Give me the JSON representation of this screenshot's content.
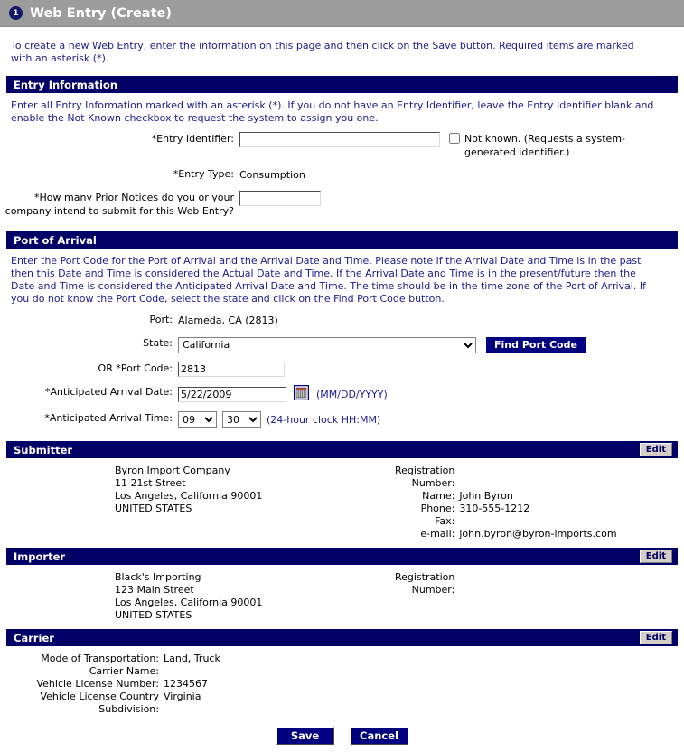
{
  "header": {
    "step_number": "1",
    "title": "Web Entry (Create)"
  },
  "intro": "To create a new Web Entry, enter the information on this page and then click on the Save button. Required items are marked with an asterisk (*).",
  "entry_information": {
    "section_title": "Entry Information",
    "description": "Enter all Entry Information marked with an asterisk (*). If you do not have an Entry Identifier, leave the Entry Identifier blank and enable the Not Known checkbox to request the system to assign you one.",
    "entry_identifier_label": "*Entry Identifier:",
    "entry_identifier_value": "",
    "not_known_label": "Not known. (Requests a system-generated identifier.)",
    "not_known_checked": false,
    "entry_type_label": "*Entry Type:",
    "entry_type_value": "Consumption",
    "prior_notices_label": "*How many Prior Notices do you or your company intend to submit for this Web Entry?",
    "prior_notices_value": ""
  },
  "port_of_arrival": {
    "section_title": "Port of Arrival",
    "description": "Enter the Port Code for the Port of Arrival and the Arrival Date and Time. Please note if the Arrival Date and Time is in the past then this Date and Time is considered the Actual Date and Time. If the Arrival Date and Time is in the present/future then the Date and Time is considered the Anticipated Arrival Date and Time. The time should be in the time zone of the Port of Arrival. If you do not know the Port Code, select the state and click on the Find Port Code button.",
    "port_label": "Port:",
    "port_value": "Alameda, CA (2813)",
    "state_label": "State:",
    "state_value": "California",
    "state_options": [
      "California"
    ],
    "find_port_code_label": "Find Port Code",
    "port_code_label": "OR *Port Code:",
    "port_code_value": "2813",
    "arrival_date_label": "*Anticipated Arrival Date:",
    "arrival_date_value": "5/22/2009",
    "date_format_hint": "(MM/DD/YYYY)",
    "arrival_time_label": "*Anticipated Arrival Time:",
    "arrival_hour_value": "09",
    "arrival_hour_options": [
      "09"
    ],
    "arrival_minute_value": "30",
    "arrival_minute_options": [
      "30"
    ],
    "time_format_hint": "(24-hour clock HH:MM)"
  },
  "submitter": {
    "section_title": "Submitter",
    "edit_label": "Edit",
    "address_lines": [
      "Byron Import Company",
      "11 21st Street",
      "Los Angeles, California  90001",
      "UNITED STATES"
    ],
    "details": [
      {
        "key": "Registration\nNumber:",
        "value": ""
      },
      {
        "key": "Name:",
        "value": "John Byron"
      },
      {
        "key": "Phone:",
        "value": "310-555-1212"
      },
      {
        "key": "Fax:",
        "value": ""
      },
      {
        "key": "e-mail:",
        "value": "john.byron@byron-imports.com"
      }
    ]
  },
  "importer": {
    "section_title": "Importer",
    "edit_label": "Edit",
    "address_lines": [
      "Black's Importing",
      "123 Main Street",
      "Los Angeles, California  90001",
      "UNITED STATES"
    ],
    "details": [
      {
        "key": "Registration\nNumber:",
        "value": ""
      }
    ]
  },
  "carrier": {
    "section_title": "Carrier",
    "edit_label": "Edit",
    "details": [
      {
        "key": "Mode of Transportation:",
        "value": "Land, Truck"
      },
      {
        "key": "Carrier Name:",
        "value": ""
      },
      {
        "key": "Vehicle License Number:",
        "value": "1234567"
      },
      {
        "key": "Vehicle License Country Subdivision:",
        "value": "Virginia"
      }
    ]
  },
  "footer": {
    "save_label": "Save",
    "cancel_label": "Cancel"
  },
  "colors": {
    "titlebar": "#9c9c9c",
    "section_bar": "#000066",
    "accent_text": "#1c1c8c",
    "button_navy": "#000080",
    "edit_button_face": "#d4d0c8"
  }
}
